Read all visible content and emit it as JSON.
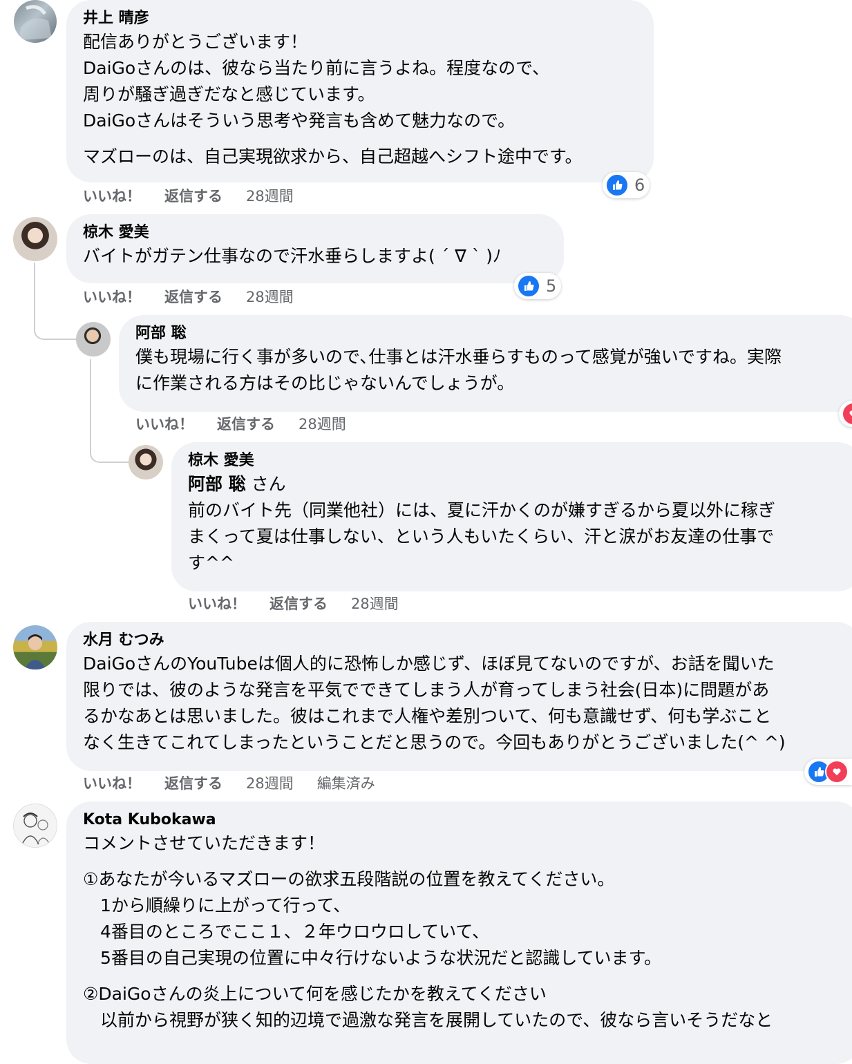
{
  "comments": [
    {
      "author": "井上 晴彦",
      "lines": [
        "配信ありがとうございます！",
        "DaiGoさんのは、彼なら当たり前に言うよね。程度なので、",
        "周りが騒ぎ過ぎだなと感じています。",
        "DaiGoさんはそういう思考や発言も含めて魅力なので。"
      ],
      "lines2": [
        "マズローのは、自己実現欲求から、自己超越へシフト途中です。"
      ],
      "like": "いいね！",
      "reply": "返信する",
      "time": "28週間",
      "reaction_count": "6"
    },
    {
      "author": "椋木 愛美",
      "lines": [
        "バイトがガテン仕事なので汗水垂らしますよ( ´ ∇ ` )ﾉ"
      ],
      "like": "いいね！",
      "reply": "返信する",
      "time": "28週間",
      "reaction_count": "5"
    },
    {
      "author": "阿部 聡",
      "lines": [
        "僕も現場に行く事が多いので､仕事とは汗水垂らすものって感覚が強いですね。実際",
        "に作業される方はその比じゃないんでしょうが。"
      ],
      "like": "いいね！",
      "reply": "返信する",
      "time": "28週間"
    },
    {
      "author": "椋木 愛美",
      "mention": "阿部 聡",
      "mention_suffix": " さん",
      "lines": [
        "前のバイト先（同業他社）には、夏に汗かくのが嫌すぎるから夏以外に稼ぎ",
        "まくって夏は仕事しない、という人もいたくらい、汗と涙がお友達の仕事で",
        "す^^"
      ],
      "like": "いいね！",
      "reply": "返信する",
      "time": "28週間"
    },
    {
      "author": "水月 むつみ",
      "lines": [
        "DaiGoさんのYouTubeは個人的に恐怖しか感じず、ほぼ見てないのですが、お話を聞いた",
        "限りでは、彼のような発言を平気でできてしまう人が育ってしまう社会(日本)に問題があ",
        "るかなあとは思いました。彼はこれまで人権や差別ついて、何も意識せず、何も学ぶこと",
        "なく生きてこれてしまったということだと思うので。今回もありがとうございました(^ ^)"
      ],
      "like": "いいね！",
      "reply": "返信する",
      "time": "28週間",
      "edited": "編集済み"
    },
    {
      "author": "Kota Kubokawa",
      "lines": [
        "コメントさせていただきます！"
      ],
      "lines2": [
        "①あなたが今いるマズローの欲求五段階説の位置を教えてください。",
        "　1から順繰りに上がって行って、",
        "　4番目のところでここ１、２年ウロウロしていて、",
        "　5番目の自己実現の位置に中々行けないような状況だと認識しています。"
      ],
      "lines3": [
        "②DaiGoさんの炎上について何を感じたかを教えてください",
        "　以前から視野が狭く知的辺境で過激な発言を展開していたので、彼なら言いそうだなと"
      ]
    }
  ],
  "icons": {
    "like": "thumbs-up-icon",
    "love": "heart-icon"
  },
  "colors": {
    "bubble": "#f0f2f5",
    "like_blue": "#1877f2",
    "love_red": "#f33e58",
    "meta_gray": "#65676b"
  }
}
